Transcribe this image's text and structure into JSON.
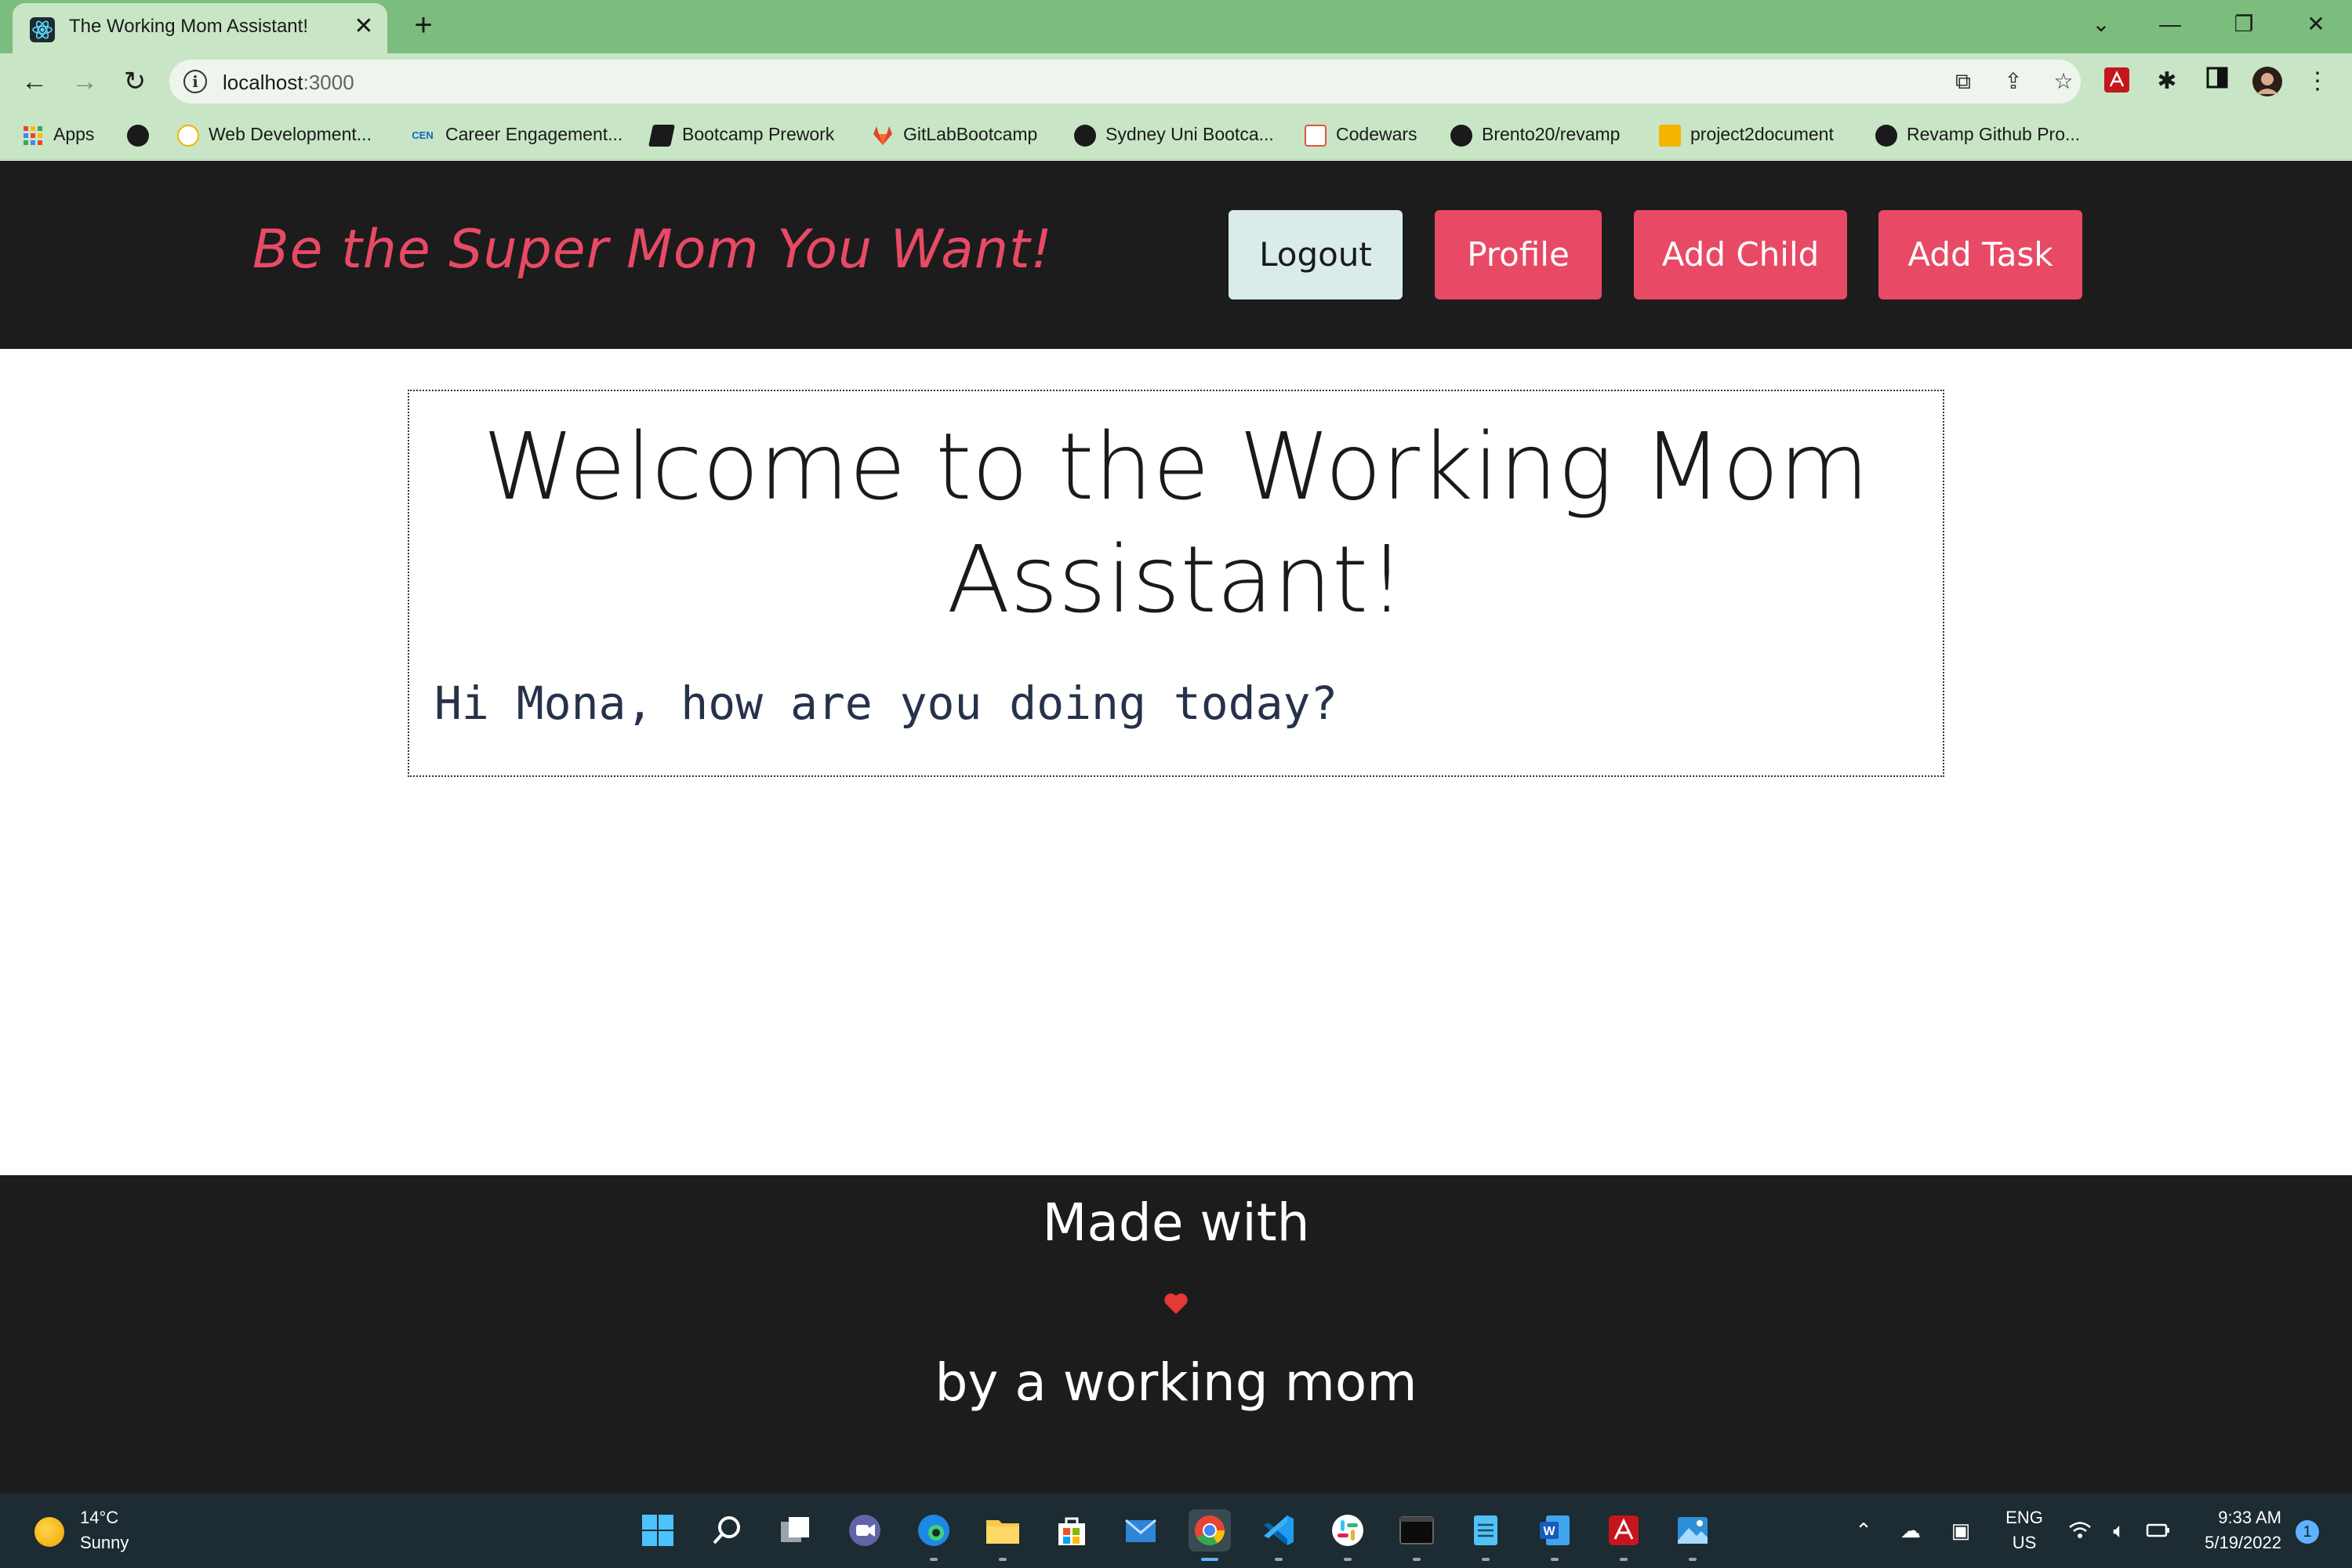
{
  "browser": {
    "tab_title": "The Working Mom Assistant!",
    "tab_close": "✕",
    "new_tab": "+",
    "window_controls": {
      "tab_search": "⌄",
      "minimize": "—",
      "restore": "❐",
      "close": "✕"
    },
    "url_host": "localhost",
    "url_port": ":3000",
    "bookmarks": [
      {
        "label": "Apps",
        "icon": "apps-grid-icon"
      },
      {
        "label": "",
        "icon": "globe-icon"
      },
      {
        "label": "Web Development...",
        "icon": "bookmark-icon"
      },
      {
        "label": "Career Engagement...",
        "icon": "cen-icon"
      },
      {
        "label": "Bootcamp Prework",
        "icon": "book-icon"
      },
      {
        "label": "GitLabBootcamp",
        "icon": "gitlab-icon"
      },
      {
        "label": "Sydney Uni Bootca...",
        "icon": "globe-icon"
      },
      {
        "label": "Codewars",
        "icon": "codewars-icon"
      },
      {
        "label": "Brento20/revamp",
        "icon": "github-icon"
      },
      {
        "label": "project2document",
        "icon": "slides-icon"
      },
      {
        "label": "Revamp Github Pro...",
        "icon": "github-icon"
      }
    ]
  },
  "site": {
    "tagline": "Be the Super Mom You Want!",
    "buttons": {
      "logout": "Logout",
      "profile": "Profile",
      "add_child": "Add Child",
      "add_task": "Add Task"
    },
    "welcome_line1": "Welcome to the Working Mom",
    "welcome_line2": "Assistant!",
    "greeting": "Hi Mona, how are you doing today?",
    "footer_made": "Made with",
    "footer_by": "by a working mom",
    "accent_color": "#e84a65"
  },
  "taskbar": {
    "temperature": "14°C",
    "condition": "Sunny",
    "language": "ENG",
    "region": "US",
    "time": "9:33 AM",
    "date": "5/19/2022",
    "notifications": "1"
  }
}
